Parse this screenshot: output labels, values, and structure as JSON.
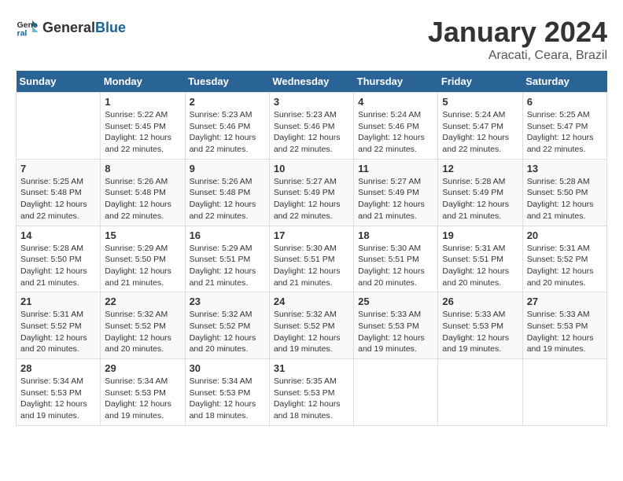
{
  "logo": {
    "general": "General",
    "blue": "Blue"
  },
  "title": "January 2024",
  "location": "Aracati, Ceara, Brazil",
  "days_header": [
    "Sunday",
    "Monday",
    "Tuesday",
    "Wednesday",
    "Thursday",
    "Friday",
    "Saturday"
  ],
  "weeks": [
    [
      {
        "day": "",
        "info": ""
      },
      {
        "day": "1",
        "info": "Sunrise: 5:22 AM\nSunset: 5:45 PM\nDaylight: 12 hours\nand 22 minutes."
      },
      {
        "day": "2",
        "info": "Sunrise: 5:23 AM\nSunset: 5:46 PM\nDaylight: 12 hours\nand 22 minutes."
      },
      {
        "day": "3",
        "info": "Sunrise: 5:23 AM\nSunset: 5:46 PM\nDaylight: 12 hours\nand 22 minutes."
      },
      {
        "day": "4",
        "info": "Sunrise: 5:24 AM\nSunset: 5:46 PM\nDaylight: 12 hours\nand 22 minutes."
      },
      {
        "day": "5",
        "info": "Sunrise: 5:24 AM\nSunset: 5:47 PM\nDaylight: 12 hours\nand 22 minutes."
      },
      {
        "day": "6",
        "info": "Sunrise: 5:25 AM\nSunset: 5:47 PM\nDaylight: 12 hours\nand 22 minutes."
      }
    ],
    [
      {
        "day": "7",
        "info": "Sunrise: 5:25 AM\nSunset: 5:48 PM\nDaylight: 12 hours\nand 22 minutes."
      },
      {
        "day": "8",
        "info": "Sunrise: 5:26 AM\nSunset: 5:48 PM\nDaylight: 12 hours\nand 22 minutes."
      },
      {
        "day": "9",
        "info": "Sunrise: 5:26 AM\nSunset: 5:48 PM\nDaylight: 12 hours\nand 22 minutes."
      },
      {
        "day": "10",
        "info": "Sunrise: 5:27 AM\nSunset: 5:49 PM\nDaylight: 12 hours\nand 22 minutes."
      },
      {
        "day": "11",
        "info": "Sunrise: 5:27 AM\nSunset: 5:49 PM\nDaylight: 12 hours\nand 21 minutes."
      },
      {
        "day": "12",
        "info": "Sunrise: 5:28 AM\nSunset: 5:49 PM\nDaylight: 12 hours\nand 21 minutes."
      },
      {
        "day": "13",
        "info": "Sunrise: 5:28 AM\nSunset: 5:50 PM\nDaylight: 12 hours\nand 21 minutes."
      }
    ],
    [
      {
        "day": "14",
        "info": "Sunrise: 5:28 AM\nSunset: 5:50 PM\nDaylight: 12 hours\nand 21 minutes."
      },
      {
        "day": "15",
        "info": "Sunrise: 5:29 AM\nSunset: 5:50 PM\nDaylight: 12 hours\nand 21 minutes."
      },
      {
        "day": "16",
        "info": "Sunrise: 5:29 AM\nSunset: 5:51 PM\nDaylight: 12 hours\nand 21 minutes."
      },
      {
        "day": "17",
        "info": "Sunrise: 5:30 AM\nSunset: 5:51 PM\nDaylight: 12 hours\nand 21 minutes."
      },
      {
        "day": "18",
        "info": "Sunrise: 5:30 AM\nSunset: 5:51 PM\nDaylight: 12 hours\nand 20 minutes."
      },
      {
        "day": "19",
        "info": "Sunrise: 5:31 AM\nSunset: 5:51 PM\nDaylight: 12 hours\nand 20 minutes."
      },
      {
        "day": "20",
        "info": "Sunrise: 5:31 AM\nSunset: 5:52 PM\nDaylight: 12 hours\nand 20 minutes."
      }
    ],
    [
      {
        "day": "21",
        "info": "Sunrise: 5:31 AM\nSunset: 5:52 PM\nDaylight: 12 hours\nand 20 minutes."
      },
      {
        "day": "22",
        "info": "Sunrise: 5:32 AM\nSunset: 5:52 PM\nDaylight: 12 hours\nand 20 minutes."
      },
      {
        "day": "23",
        "info": "Sunrise: 5:32 AM\nSunset: 5:52 PM\nDaylight: 12 hours\nand 20 minutes."
      },
      {
        "day": "24",
        "info": "Sunrise: 5:32 AM\nSunset: 5:52 PM\nDaylight: 12 hours\nand 19 minutes."
      },
      {
        "day": "25",
        "info": "Sunrise: 5:33 AM\nSunset: 5:53 PM\nDaylight: 12 hours\nand 19 minutes."
      },
      {
        "day": "26",
        "info": "Sunrise: 5:33 AM\nSunset: 5:53 PM\nDaylight: 12 hours\nand 19 minutes."
      },
      {
        "day": "27",
        "info": "Sunrise: 5:33 AM\nSunset: 5:53 PM\nDaylight: 12 hours\nand 19 minutes."
      }
    ],
    [
      {
        "day": "28",
        "info": "Sunrise: 5:34 AM\nSunset: 5:53 PM\nDaylight: 12 hours\nand 19 minutes."
      },
      {
        "day": "29",
        "info": "Sunrise: 5:34 AM\nSunset: 5:53 PM\nDaylight: 12 hours\nand 19 minutes."
      },
      {
        "day": "30",
        "info": "Sunrise: 5:34 AM\nSunset: 5:53 PM\nDaylight: 12 hours\nand 18 minutes."
      },
      {
        "day": "31",
        "info": "Sunrise: 5:35 AM\nSunset: 5:53 PM\nDaylight: 12 hours\nand 18 minutes."
      },
      {
        "day": "",
        "info": ""
      },
      {
        "day": "",
        "info": ""
      },
      {
        "day": "",
        "info": ""
      }
    ]
  ]
}
